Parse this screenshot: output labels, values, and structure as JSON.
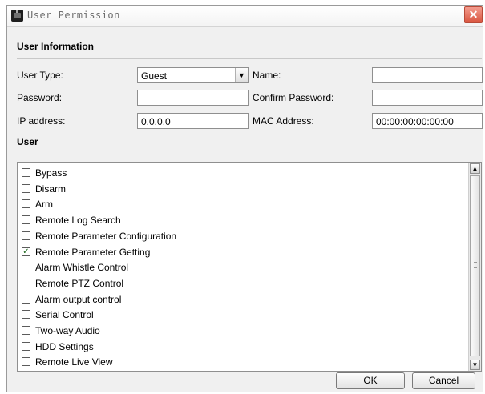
{
  "window": {
    "title": "User Permission",
    "close_symbol": "✕"
  },
  "user_info": {
    "section_label": "User Information",
    "user_type_label": "User Type:",
    "user_type_value": "Guest",
    "name_label": "Name:",
    "name_value": "",
    "password_label": "Password:",
    "password_value": "",
    "confirm_password_label": "Confirm Password:",
    "confirm_password_value": "",
    "ip_label": "IP address:",
    "ip_value": "0.0.0.0",
    "mac_label": "MAC Address:",
    "mac_value": "00:00:00:00:00:00"
  },
  "user_section": {
    "label": "User"
  },
  "permissions": [
    {
      "label": "Bypass",
      "checked": false
    },
    {
      "label": "Disarm",
      "checked": false
    },
    {
      "label": "Arm",
      "checked": false
    },
    {
      "label": "Remote Log Search",
      "checked": false
    },
    {
      "label": "Remote Parameter Configuration",
      "checked": false
    },
    {
      "label": "Remote Parameter Getting",
      "checked": true
    },
    {
      "label": "Alarm Whistle Control",
      "checked": false
    },
    {
      "label": "Remote PTZ Control",
      "checked": false
    },
    {
      "label": "Alarm output control",
      "checked": false
    },
    {
      "label": "Serial Control",
      "checked": false
    },
    {
      "label": "Two-way Audio",
      "checked": false
    },
    {
      "label": "HDD Settings",
      "checked": false
    },
    {
      "label": "Remote Live View",
      "checked": false
    }
  ],
  "buttons": {
    "ok": "OK",
    "cancel": "Cancel"
  }
}
